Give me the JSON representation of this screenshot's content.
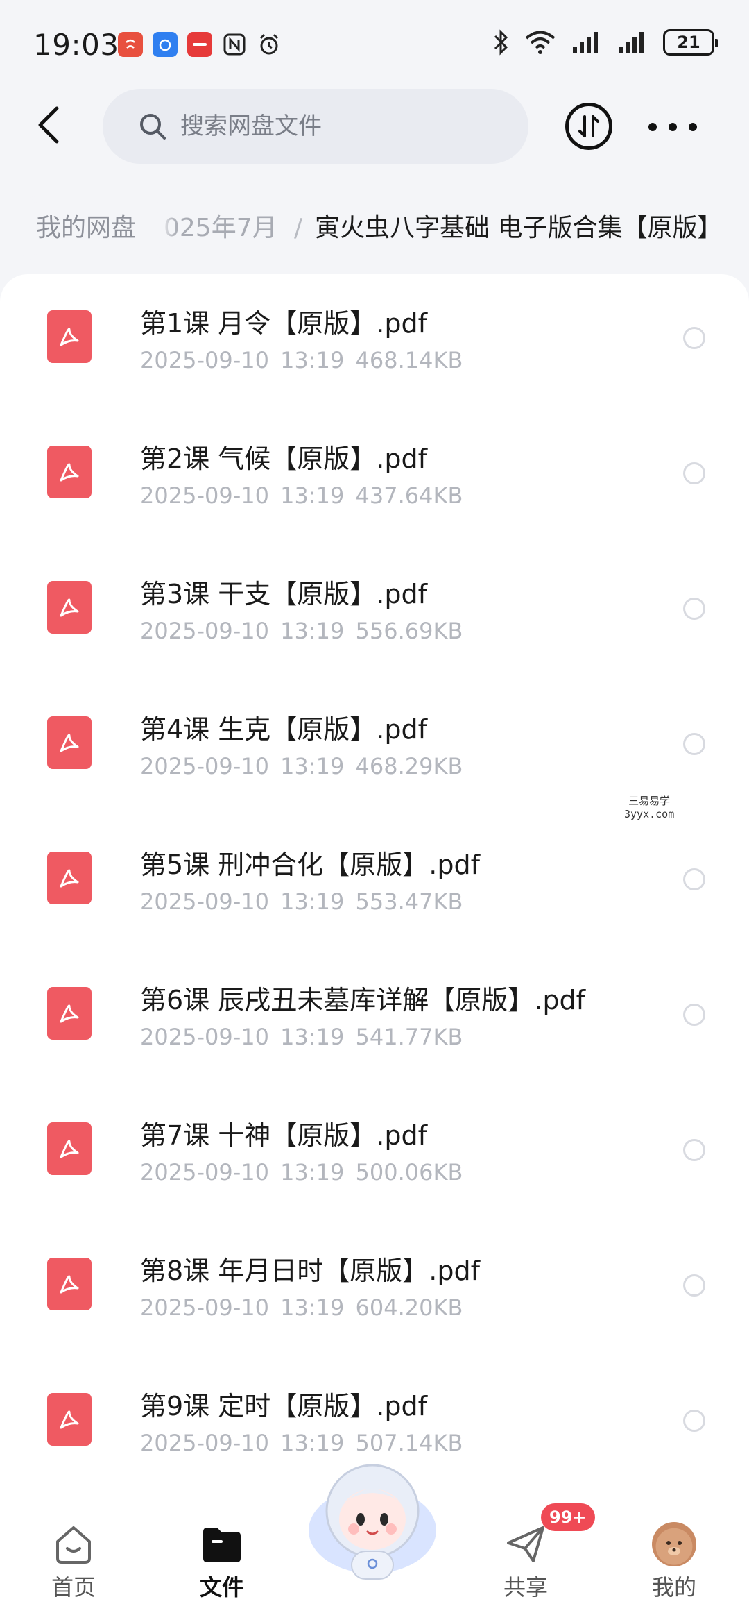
{
  "status_bar": {
    "time": "19:03",
    "battery_level": "21",
    "notification_icons": [
      "notif-app-red",
      "notif-app-blue",
      "notif-huawei",
      "nfc-icon",
      "alarm-icon"
    ]
  },
  "top_bar": {
    "search_placeholder": "搜索网盘文件"
  },
  "breadcrumb": {
    "root": "我的网盘",
    "middle": "025年7月",
    "separator": "/",
    "current": "寅火虫八字基础 电子版合集【原版】"
  },
  "files": [
    {
      "name": "第1课 月令【原版】.pdf",
      "date": "2025-09-10",
      "time": "13:19",
      "size": "468.14KB"
    },
    {
      "name": "第2课 气候【原版】.pdf",
      "date": "2025-09-10",
      "time": "13:19",
      "size": "437.64KB"
    },
    {
      "name": "第3课 干支【原版】.pdf",
      "date": "2025-09-10",
      "time": "13:19",
      "size": "556.69KB"
    },
    {
      "name": "第4课 生克【原版】.pdf",
      "date": "2025-09-10",
      "time": "13:19",
      "size": "468.29KB"
    },
    {
      "name": "第5课 刑冲合化【原版】.pdf",
      "date": "2025-09-10",
      "time": "13:19",
      "size": "553.47KB"
    },
    {
      "name": "第6课 辰戌丑未墓库详解【原版】.pdf",
      "date": "2025-09-10",
      "time": "13:19",
      "size": "541.77KB"
    },
    {
      "name": "第7课 十神【原版】.pdf",
      "date": "2025-09-10",
      "time": "13:19",
      "size": "500.06KB"
    },
    {
      "name": "第8课 年月日时【原版】.pdf",
      "date": "2025-09-10",
      "time": "13:19",
      "size": "604.20KB"
    },
    {
      "name": "第9课 定时【原版】.pdf",
      "date": "2025-09-10",
      "time": "13:19",
      "size": "507.14KB"
    }
  ],
  "watermark": {
    "line1": "三易易学",
    "line2": "3yyx.com"
  },
  "bottom_nav": {
    "home": "首页",
    "files": "文件",
    "share": "共享",
    "share_badge": "99+",
    "mine": "我的"
  },
  "colors": {
    "pdf_red": "#ef5a62",
    "badge_red": "#ef4a55",
    "accent_dark": "#111111"
  }
}
